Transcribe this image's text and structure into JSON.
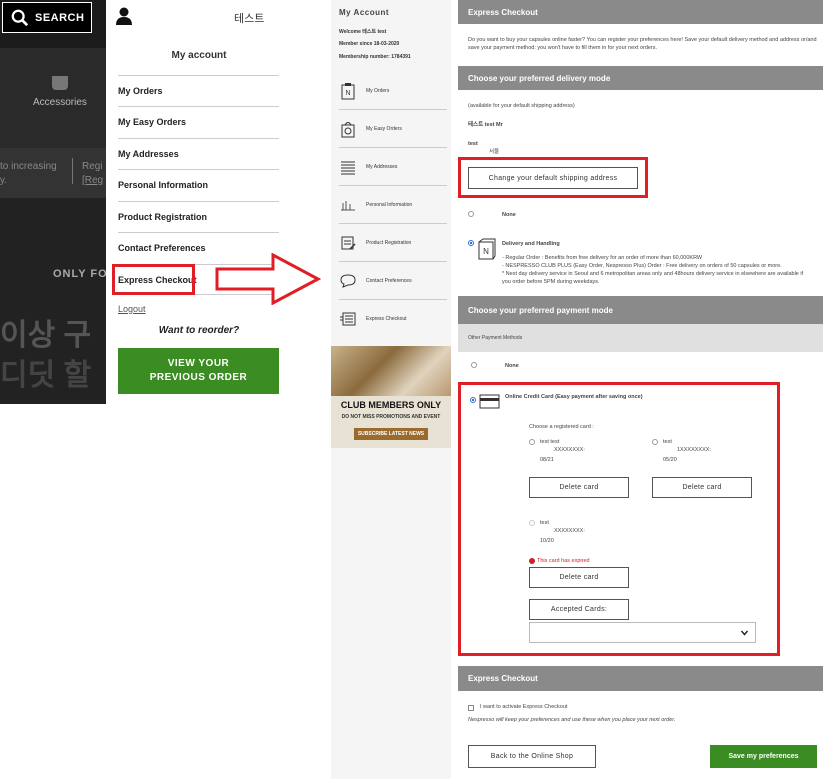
{
  "left_panel": {
    "search_label": "SEARCH",
    "accessories_label": "Accessories",
    "promo_fragment_1": "to increasing",
    "promo_fragment_1b": "y.",
    "promo_fragment_2": "Regi",
    "promo_fragment_2b": "[Reg",
    "only_for": "ONLY FO",
    "korean_line_1": "이상 구",
    "korean_line_2": "디딧 할"
  },
  "account_menu": {
    "username": "테스트",
    "title": "My account",
    "items": [
      {
        "label": "My Orders"
      },
      {
        "label": "My Easy Orders"
      },
      {
        "label": "My Addresses"
      },
      {
        "label": "Personal Information"
      },
      {
        "label": "Product Registration"
      },
      {
        "label": "Contact Preferences"
      },
      {
        "label": "Express Checkout"
      }
    ],
    "logout": "Logout",
    "reorder_prompt": "Want to reorder?",
    "reorder_button_line1": "VIEW YOUR",
    "reorder_button_line2": "PREVIOUS ORDER"
  },
  "sidebar": {
    "title": "My Account",
    "welcome": "Welcome 테스트 test",
    "member_since": "Member since 18-03-2020",
    "membership_number": "Membership number: 1784391",
    "items": [
      {
        "label": "My Orders",
        "icon": "orders-icon"
      },
      {
        "label": "My Easy Orders",
        "icon": "easy-orders-icon"
      },
      {
        "label": "My Addresses",
        "icon": "addresses-icon"
      },
      {
        "label": "Personal Information",
        "icon": "personal-info-icon"
      },
      {
        "label": "Product Registration",
        "icon": "product-registration-icon"
      },
      {
        "label": "Contact Preferences",
        "icon": "contact-preferences-icon"
      },
      {
        "label": "Express Checkout",
        "icon": "express-checkout-icon"
      }
    ],
    "promo_title": "CLUB MEMBERS ONLY",
    "promo_subtitle": "DO NOT MISS PROMOTIONS AND EVENT",
    "promo_button": "SUBSCRIBE LATEST NEWS"
  },
  "main": {
    "express_header": "Express Checkout",
    "intro": "Do you want to buy your capsules online faster? You can register your preferences here! Save your default delivery method and address or/and save your payment method: you won't have to fill them in for your next orders.",
    "delivery_header": "Choose your preferred delivery mode",
    "shipping_note": "(available for your default shipping address)",
    "addr_name": "테스트 test Mr",
    "addr_line": "test",
    "addr_city": "서울",
    "change_address_button": "Change your default shipping address",
    "delivery_none": "None",
    "delivery_option_title": "Delivery and Handling",
    "delivery_option_line1": "- Regular Order : Benefits from free delivery for an order of more than 60,000KRW",
    "delivery_option_line2": "- NESPRESSO CLUB PLUS (Easy Order, Nespresso Plus) Order : Free delivery on orders of 50 capsules or more.",
    "delivery_option_line3": "* Next day delivery service in Seoul and 6 metropolitan areas only and 48hours delivery service in elsewhere are available if",
    "delivery_option_line4": "you order before 5PM during weekdays.",
    "payment_header": "Choose your preferred payment mode",
    "other_payment": "Other Payment Methods",
    "payment_none": "None",
    "credit_card_label": "Online Credit Card (Easy payment after saving once)",
    "choose_card": "Choose a registered card :",
    "cards": [
      {
        "name": "test test",
        "number": "XXXXXXXX:",
        "expiry": "08/21",
        "delete": "Delete card"
      },
      {
        "name": "test",
        "number": "1XXXXXXXX:",
        "expiry": "05/20",
        "delete": "Delete card"
      },
      {
        "name": "test",
        "number": "XXXXXXXX:",
        "expiry": "10/20",
        "delete": "Delete card",
        "expired_note": "This card has expired"
      }
    ],
    "accepted_cards": "Accepted Cards:",
    "express_header_2": "Express Checkout",
    "activate_label": "I want to activate Express Checkout",
    "activate_note": "Nespresso will keep your preferences and use these when you place your next order.",
    "back_button": "Back to the Online Shop",
    "save_button": "Save my preferences"
  },
  "colors": {
    "highlight": "#e01e26",
    "green": "#3b8c22",
    "section_header": "#8a8a8a"
  }
}
